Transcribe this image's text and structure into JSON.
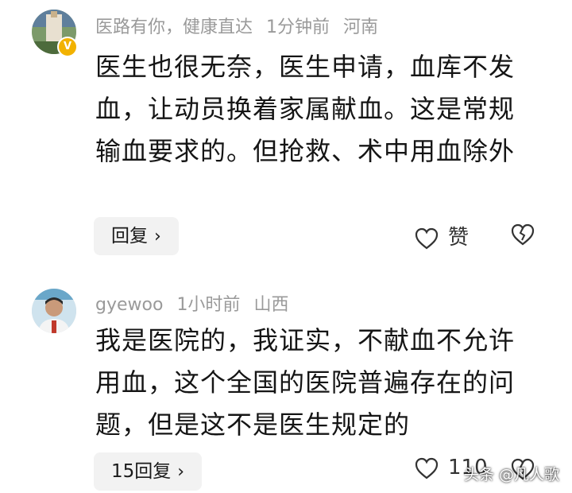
{
  "comments": [
    {
      "user": "医路有你，健康直达",
      "time": "1分钟前",
      "location": "河南",
      "badge": "V",
      "text": "医生也很无奈，医生申请，血库不发血，让动员换着家属献血。这是常规输血要求的。但抢救、术中用血除外",
      "reply_label": "回复",
      "like_label": "赞"
    },
    {
      "user": "gyewoo",
      "time": "1小时前",
      "location": "山西",
      "text": "我是医院的，我证实，不献血不允许用血，这个全国的医院普遍存在的问题，但是这不是医生规定的",
      "reply_label": "15回复",
      "like_label": "110"
    }
  ],
  "watermark": "头条 @凡人歌",
  "icons": {
    "like": "heart-outline-icon",
    "dislike": "broken-heart-icon",
    "chevron": "chevron-right-icon"
  },
  "colors": {
    "meta": "#9a9a9a",
    "badge": "#f2b200",
    "button_bg": "#f2f2f2"
  }
}
